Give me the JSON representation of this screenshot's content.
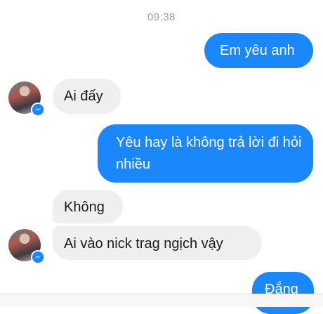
{
  "chat": {
    "timestamp": "09:38",
    "messages": [
      {
        "from": "me",
        "text": "Em yêu anh"
      },
      {
        "from": "them",
        "text": "Ai đấy"
      },
      {
        "from": "me",
        "text": "Yêu hay là không trả lời đi hỏi nhiều"
      },
      {
        "from": "them",
        "text": "Không"
      },
      {
        "from": "them",
        "text": "Ai vào nick trag ngịch vậy"
      },
      {
        "from": "me",
        "text": "Đắng"
      }
    ]
  },
  "colors": {
    "outgoing_bubble": "#1a87fb",
    "incoming_bubble": "#efeff1",
    "messenger_badge": "#1a87fb"
  },
  "icons": [
    "messenger-icon"
  ]
}
